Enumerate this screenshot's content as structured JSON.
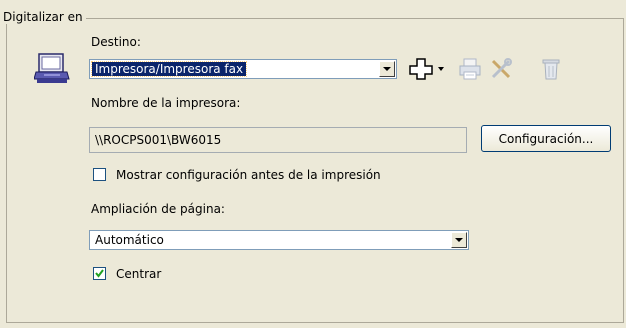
{
  "group": {
    "title": "Digitalizar en"
  },
  "destination": {
    "label": "Destino:",
    "selected": "Impresora/Impresora fax",
    "icon": "scanner-to-printer-icon"
  },
  "toolbar": {
    "add_icon": "add-icon",
    "printer_icon": "printer-icon",
    "tools_icon": "tools-icon",
    "delete_icon": "trash-icon"
  },
  "printer_name": {
    "label": "Nombre de la impresora:",
    "value": "\\\\ROCPS001\\BW6015",
    "config_button": "Configuración..."
  },
  "show_settings": {
    "label": "Mostrar configuración antes de la impresión",
    "checked": false
  },
  "page_scaling": {
    "label": "Ampliación de página:",
    "selected": "Automático"
  },
  "center": {
    "label": "Centrar",
    "checked": true
  }
}
